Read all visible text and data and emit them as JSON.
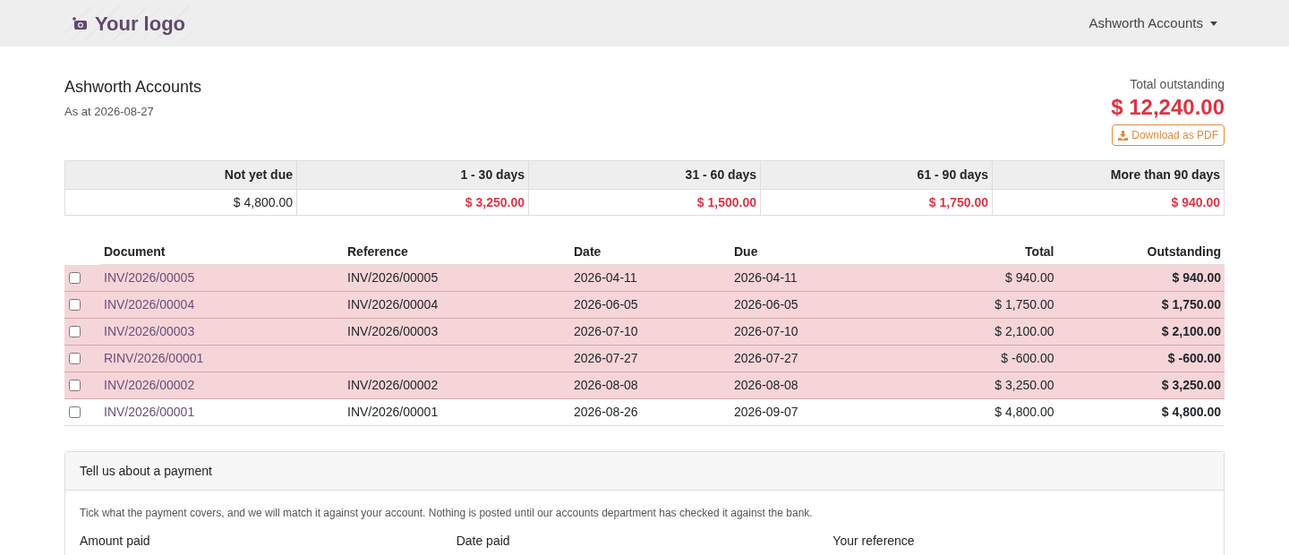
{
  "navbar": {
    "logo": "Your logo",
    "account_menu": "Ashworth Accounts"
  },
  "header": {
    "title": "Ashworth Accounts",
    "subtitle": "As at 2026-08-27",
    "total_label": "Total outstanding",
    "total_value": "$ 12,240.00",
    "download_button": "Download as PDF"
  },
  "aging": [
    {
      "label": "Not yet due",
      "value": "$ 4,800.00",
      "overdue": false
    },
    {
      "label": "1 - 30 days",
      "value": "$ 3,250.00",
      "overdue": true
    },
    {
      "label": "31 - 60 days",
      "value": "$ 1,500.00",
      "overdue": true
    },
    {
      "label": "61 - 90 days",
      "value": "$ 1,750.00",
      "overdue": true
    },
    {
      "label": "More than 90 days",
      "value": "$ 940.00",
      "overdue": true
    }
  ],
  "table": {
    "columns": [
      "Document",
      "Reference",
      "Date",
      "Due",
      "Total",
      "Outstanding"
    ],
    "rows": [
      {
        "checked": false,
        "overdue": true,
        "document": "INV/2026/00005",
        "reference": "INV/2026/00005",
        "date": "2026-04-11",
        "due": "2026-04-11",
        "total": "$ 940.00",
        "outstanding": "$ 940.00"
      },
      {
        "checked": false,
        "overdue": true,
        "document": "INV/2026/00004",
        "reference": "INV/2026/00004",
        "date": "2026-06-05",
        "due": "2026-06-05",
        "total": "$ 1,750.00",
        "outstanding": "$ 1,750.00"
      },
      {
        "checked": false,
        "overdue": true,
        "document": "INV/2026/00003",
        "reference": "INV/2026/00003",
        "date": "2026-07-10",
        "due": "2026-07-10",
        "total": "$ 2,100.00",
        "outstanding": "$ 2,100.00"
      },
      {
        "checked": false,
        "overdue": true,
        "document": "RINV/2026/00001",
        "date": "2026-07-27",
        "due": "2026-07-27",
        "total": "$ -600.00",
        "outstanding": "$ -600.00"
      },
      {
        "checked": false,
        "overdue": true,
        "document": "INV/2026/00002",
        "reference": "INV/2026/00002",
        "date": "2026-08-08",
        "due": "2026-08-08",
        "total": "$ 3,250.00",
        "outstanding": "$ 3,250.00"
      },
      {
        "checked": false,
        "overdue": false,
        "document": "INV/2026/00001",
        "reference": "INV/2026/00001",
        "date": "2026-08-26",
        "due": "2026-09-07",
        "total": "$ 4,800.00",
        "outstanding": "$ 4,800.00"
      }
    ]
  },
  "payment_card": {
    "title": "Tell us about a payment",
    "description": "Tick what the payment covers, and we will match it against your account. Nothing is posted until our accounts department has checked it against the bank.",
    "fields": [
      "Amount paid",
      "Date paid",
      "Your reference"
    ]
  }
}
